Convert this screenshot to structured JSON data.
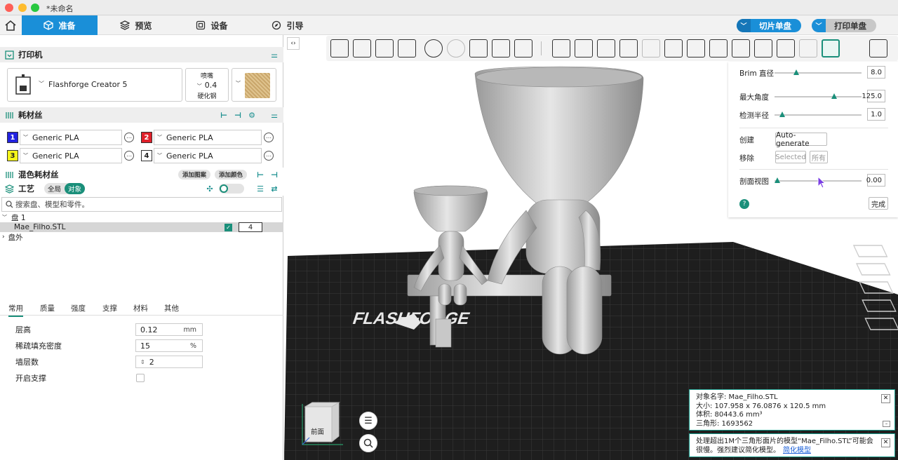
{
  "window": {
    "title": "*未命名"
  },
  "nav": {
    "tabs": [
      {
        "label": "准备"
      },
      {
        "label": "预览"
      },
      {
        "label": "设备"
      },
      {
        "label": "引导"
      }
    ]
  },
  "actions": {
    "slice_label": "切片单盘",
    "print_label": "打印单盘"
  },
  "printer": {
    "section_title": "打印机",
    "name": "Flashforge Creator 5",
    "nozzle_label": "喷嘴",
    "nozzle_size": "0.4",
    "nozzle_type": "硬化钢"
  },
  "filament": {
    "section_title": "耗材丝",
    "slots": [
      {
        "num": "1",
        "name": "Generic PLA",
        "color": "#2222e0",
        "text_color": "#ffffff"
      },
      {
        "num": "2",
        "name": "Generic PLA",
        "color": "#e0202a",
        "text_color": "#ffffff"
      },
      {
        "num": "3",
        "name": "Generic PLA",
        "color": "#f5f51a",
        "text_color": "#222222"
      },
      {
        "num": "4",
        "name": "Generic PLA",
        "color": "#ffffff",
        "text_color": "#222222"
      }
    ]
  },
  "mixed": {
    "title": "混色耗材丝",
    "add_pattern": "添加图案",
    "add_color": "添加颜色"
  },
  "process": {
    "title": "工艺",
    "global": "全局",
    "object": "对象"
  },
  "search": {
    "placeholder": "搜索盘、模型和零件。"
  },
  "tree": {
    "plate": "盘 1",
    "object_name": "Mae_Filho.STL",
    "object_filament": "4",
    "outside": "盘外"
  },
  "param_tabs": [
    "常用",
    "质量",
    "强度",
    "支撑",
    "材料",
    "其他"
  ],
  "params": {
    "layer_height": {
      "label": "层高",
      "value": "0.12",
      "unit": "mm"
    },
    "infill": {
      "label": "稀疏填充密度",
      "value": "15",
      "unit": "%"
    },
    "walls": {
      "label": "墙层数",
      "value": "2"
    },
    "support": {
      "label": "开启支撑"
    }
  },
  "brim_panel": {
    "brim_label": "Brim 直径",
    "brim_value": "8.0",
    "brim_fraction": 0.23,
    "angle_label": "最大角度",
    "angle_value": "125.0",
    "angle_fraction": 0.7,
    "radius_label": "检测半径",
    "radius_value": "1.0",
    "radius_fraction": 0.06,
    "create_label": "创建",
    "auto_generate": "Auto-generate",
    "remove_label": "移除",
    "selected": "Selected",
    "all": "所有",
    "section_label": "剖面视图",
    "section_value": "0.00",
    "section_fraction": 0.0,
    "done": "完成"
  },
  "viewport": {
    "front_label": "前面",
    "logo_text": "FLASHFORGE"
  },
  "object_info": {
    "name_line": "对象名字:  Mae_Filho.STL",
    "size_line": "大小:  107.958 x 76.0876 x 120.5 mm",
    "volume_line": "体积:  80443.6 mm³",
    "triangles_line": "三角形:  1693562"
  },
  "warning": {
    "text": "处理超出1M个三角形面片的模型“Mae_Filho.STL”可能会很慢。强烈建议简化模型。",
    "link": "简化模型"
  }
}
